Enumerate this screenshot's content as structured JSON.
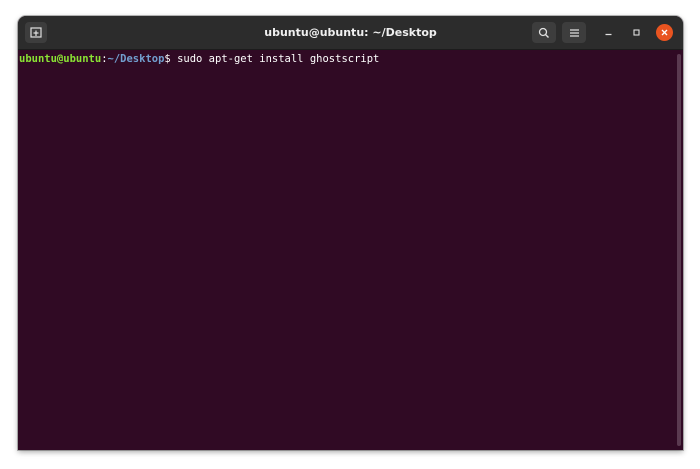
{
  "window": {
    "title": "ubuntu@ubuntu: ~/Desktop"
  },
  "titlebar": {
    "icons": {
      "new_tab": "new-tab-icon",
      "search": "search-icon",
      "menu": "hamburger-menu-icon",
      "minimize": "minimize-icon",
      "maximize": "maximize-icon",
      "close": "close-icon"
    }
  },
  "terminal": {
    "prompt_user": "ubuntu@ubuntu",
    "prompt_sep": ":",
    "prompt_path": "~/Desktop",
    "prompt_symbol": "$ ",
    "command": "sudo apt-get install ghostscript"
  },
  "colors": {
    "terminal_bg": "#300a24",
    "titlebar_bg": "#2c2c2c",
    "prompt_user": "#8ae234",
    "prompt_path": "#729fcf",
    "close_button": "#e95420"
  }
}
